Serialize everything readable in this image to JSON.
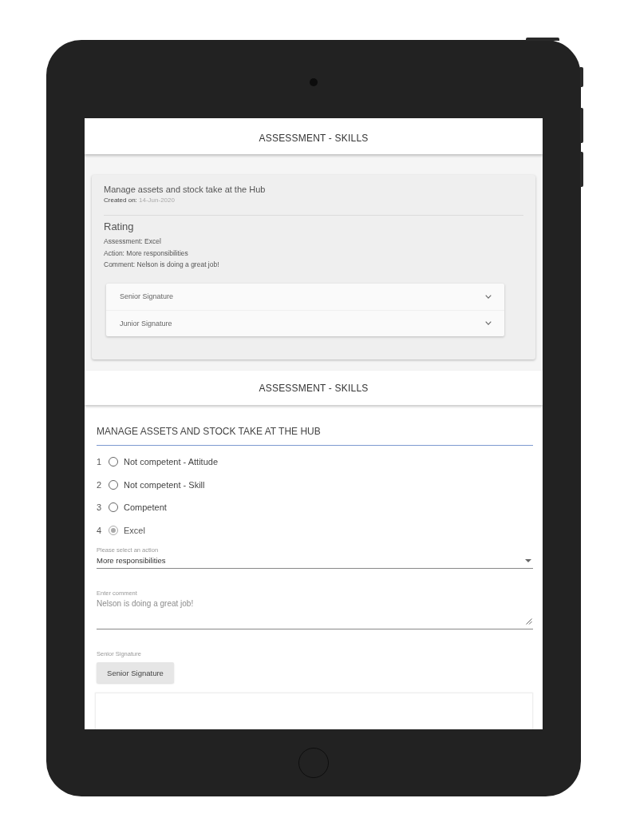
{
  "summary_header": {
    "title": "ASSESSMENT - SKILLS"
  },
  "summary_card": {
    "skill": "Manage assets and stock take at the Hub",
    "created_label": "Created on:",
    "created_date": "14-Jun-2020",
    "rating_heading": "Rating",
    "details": [
      "Assessment: Excel",
      "Action: More responsibilities",
      "Comment: Nelson is doing a great job!"
    ],
    "signature_panels": [
      {
        "label": "Senior Signature",
        "expanded": false
      },
      {
        "label": "Junior Signature",
        "expanded": false
      }
    ]
  },
  "form_header": {
    "title": "ASSESSMENT - SKILLS"
  },
  "form": {
    "skill_field": {
      "value": "MANAGE ASSETS AND STOCK TAKE AT THE HUB"
    },
    "ratings": [
      {
        "number": "1",
        "label": "Not competent - Attitude",
        "selected": false
      },
      {
        "number": "2",
        "label": "Not competent - Skill",
        "selected": false
      },
      {
        "number": "3",
        "label": "Competent",
        "selected": false
      },
      {
        "number": "4",
        "label": "Excel",
        "selected": true
      }
    ],
    "action_select": {
      "label": "Please select an action",
      "value": "More responsibilities"
    },
    "comment_field": {
      "label": "Enter comment",
      "value": "Nelson is doing a great job!"
    },
    "signature": {
      "label": "Senior Signature",
      "button": "Senior Signature"
    }
  }
}
